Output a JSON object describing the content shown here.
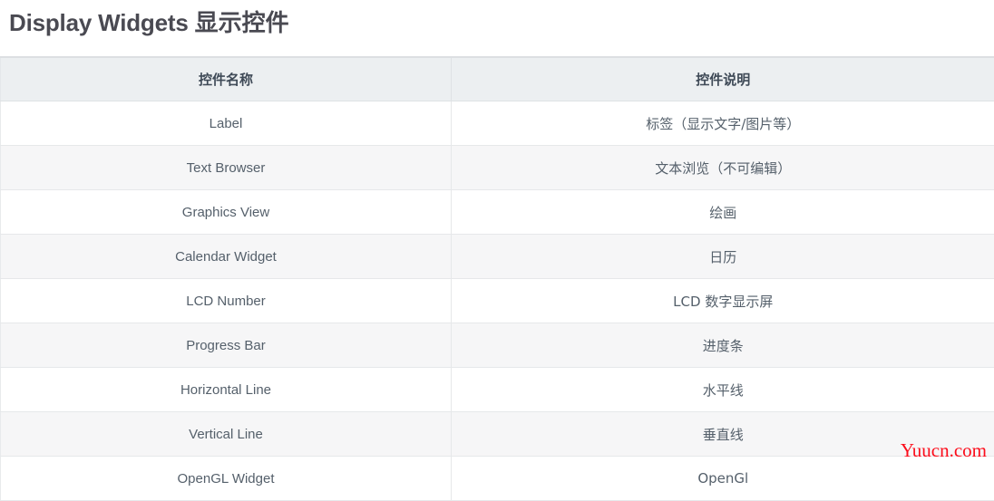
{
  "page": {
    "title_en": "Display Widgets",
    "title_cjk": "显示控件"
  },
  "table": {
    "headers": {
      "name": "控件名称",
      "description": "控件说明"
    },
    "rows": [
      {
        "name": "Label",
        "description": "标签（显示文字/图片等）"
      },
      {
        "name": "Text Browser",
        "description": "文本浏览（不可编辑）"
      },
      {
        "name": "Graphics View",
        "description": "绘画"
      },
      {
        "name": "Calendar Widget",
        "description": "日历"
      },
      {
        "name": "LCD Number",
        "description": "LCD 数字显示屏"
      },
      {
        "name": "Progress Bar",
        "description": "进度条"
      },
      {
        "name": "Horizontal Line",
        "description": "水平线"
      },
      {
        "name": "Vertical Line",
        "description": "垂直线"
      },
      {
        "name": "OpenGL Widget",
        "description": "OpenGl"
      }
    ]
  },
  "watermark": {
    "text": "Yuucn.com",
    "color": "#fc0d1b"
  },
  "colors": {
    "title": "#4a4a52",
    "header_bg": "#eceff1",
    "row_alt_bg": "#f6f6f7",
    "row_bg": "#ffffff",
    "border": "#e6e8ea",
    "text": "#55606b"
  }
}
